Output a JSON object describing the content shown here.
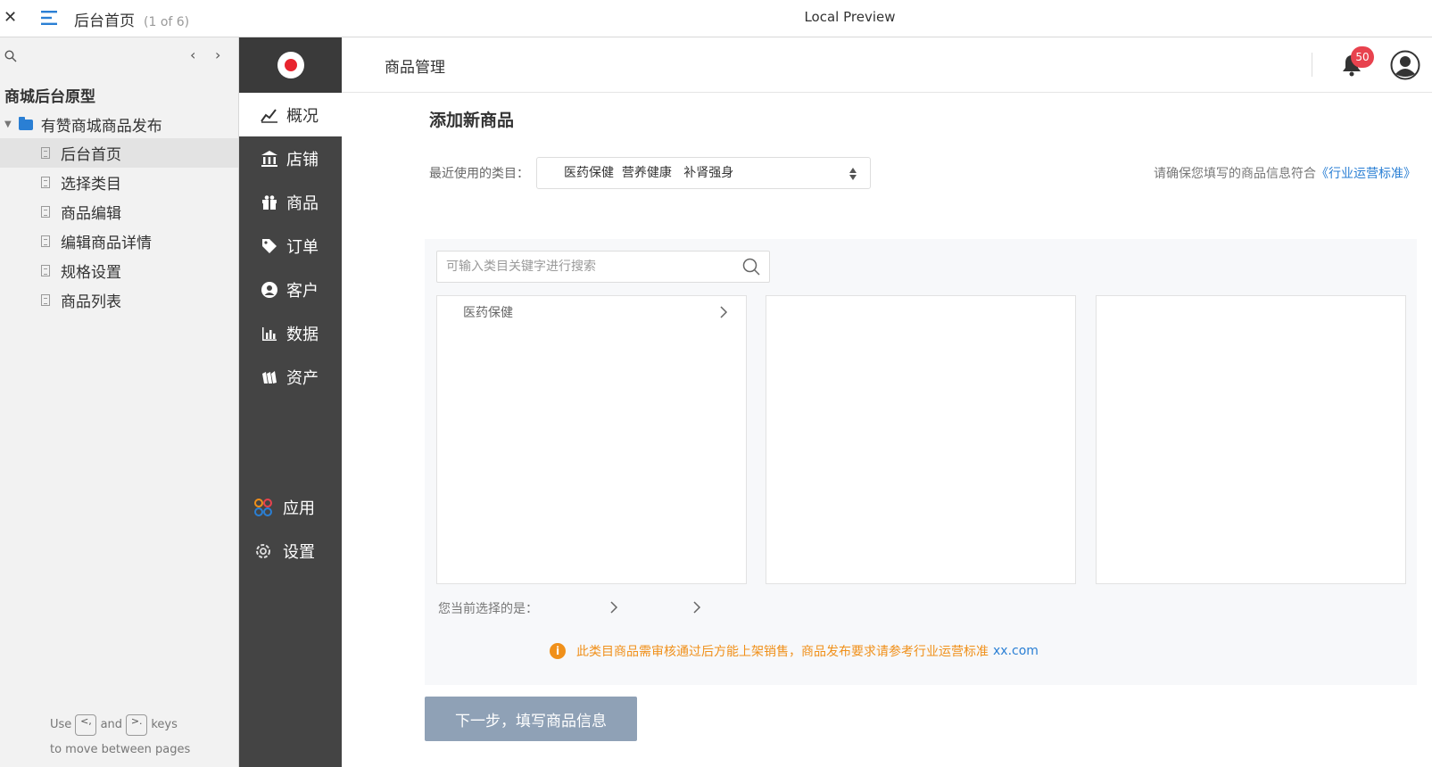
{
  "topbar": {
    "page_title": "后台首页",
    "page_count": "(1 of 6)",
    "preview_label": "Local Preview"
  },
  "sitemap": {
    "project_name": "商城后台原型",
    "folder_name": "有赞商城商品发布",
    "pages": [
      "后台首页",
      "选择类目",
      "商品编辑",
      "编辑商品详情",
      "规格设置",
      "商品列表"
    ],
    "active_page": 0,
    "hint_use": "Use",
    "hint_and": "and",
    "hint_keys": "keys",
    "hint_move": "to move between pages",
    "key_prev": "<,",
    "key_next": ">."
  },
  "nav": {
    "items": [
      "概况",
      "店铺",
      "商品",
      "订单",
      "客户",
      "数据",
      "资产"
    ],
    "bottom_items": [
      "应用",
      "设置"
    ],
    "active_index": 0
  },
  "header": {
    "title": "商品管理",
    "notification_count": "50"
  },
  "main": {
    "title": "添加新商品",
    "recent_label": "最近使用的类目：",
    "recent_value": "医药保健  营养健康   补肾强身",
    "notice_text": "请确保您填写的商品信息符合",
    "notice_link": "《行业运营标准》",
    "search_placeholder": "可输入类目关键字进行搜索",
    "categories_col1": [
      "医药保健"
    ],
    "current_label": "您当前选择的是：",
    "warning_text": "此类目商品需审核通过后方能上架销售，商品发布要求请参考行业运营标准",
    "warning_link": "xx.com",
    "next_button": "下一步，填写商品信息"
  },
  "colors": {
    "dark_nav": "#444444",
    "accent_blue": "#2a7fd4",
    "warning_orange": "#f0901a",
    "badge_red": "#e8424e",
    "button_bg": "#8fa1b6"
  }
}
